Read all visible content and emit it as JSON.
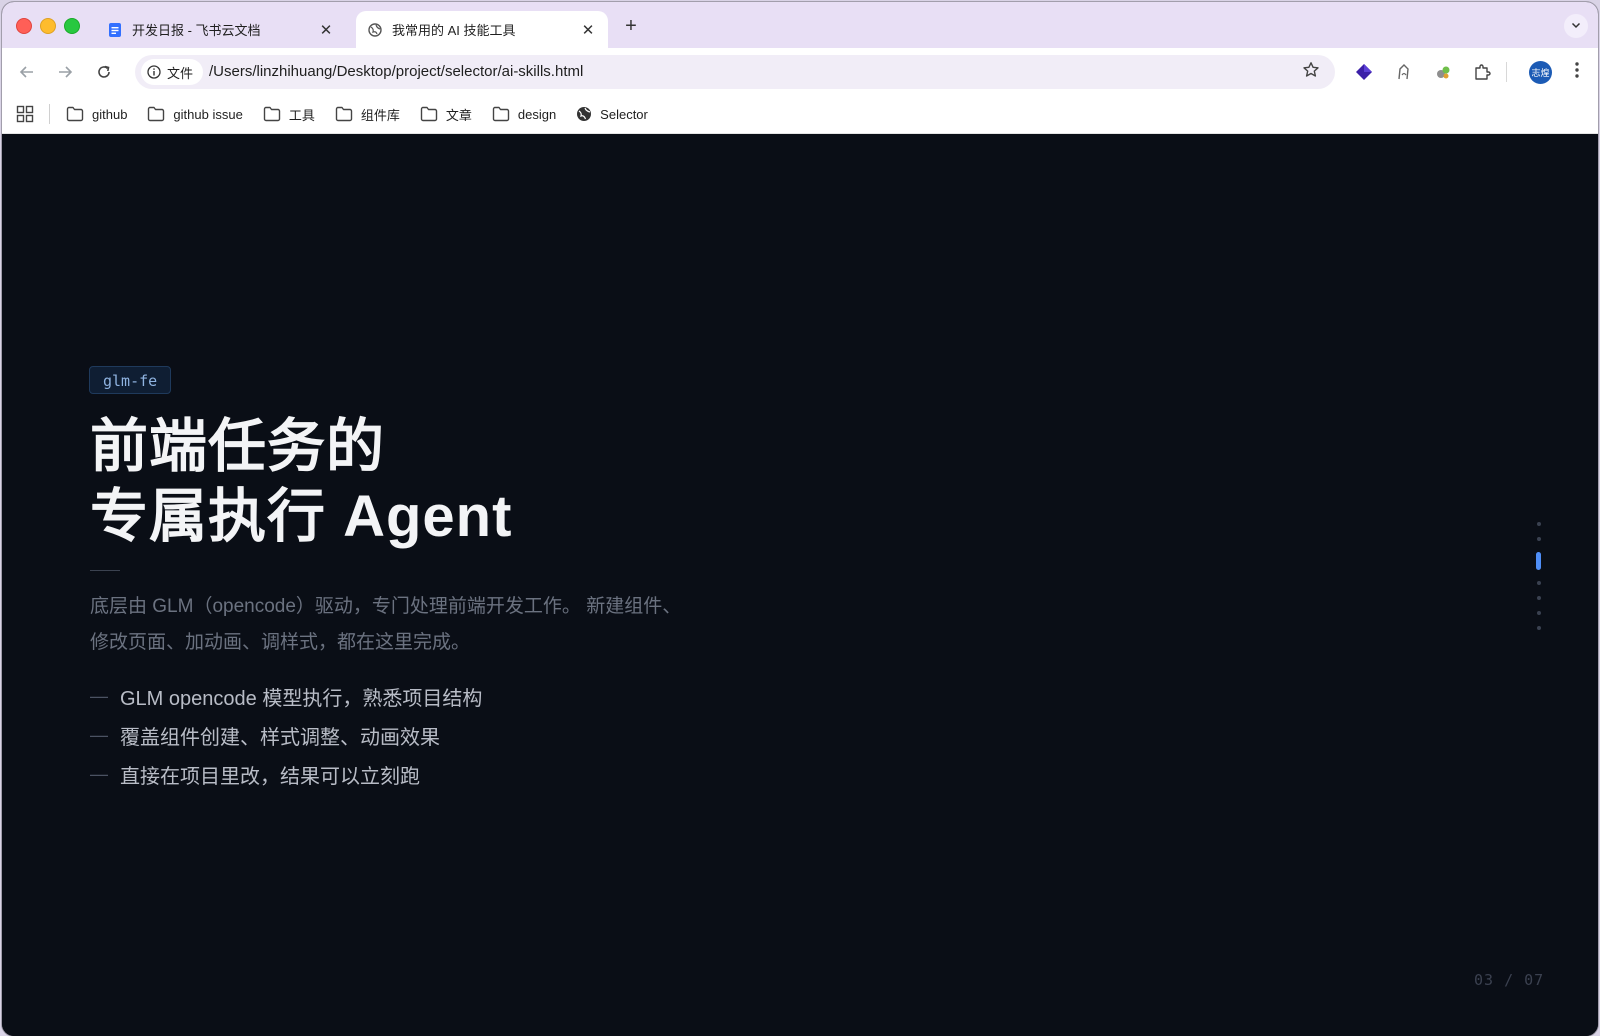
{
  "browser": {
    "tabs": [
      {
        "title": "开发日报 - 飞书云文档",
        "icon": "document-icon",
        "active": false
      },
      {
        "title": "我常用的 AI 技能工具",
        "icon": "globe-icon",
        "active": true
      }
    ],
    "new_tab_label": "+",
    "address": {
      "chip_label": "文件",
      "url": "/Users/linzhihuang/Desktop/project/selector/ai-skills.html"
    },
    "avatar_label": "志煌",
    "bookmarks": [
      {
        "label": "github",
        "icon": "folder-icon"
      },
      {
        "label": "github issue",
        "icon": "folder-icon"
      },
      {
        "label": "工具",
        "icon": "folder-icon"
      },
      {
        "label": "组件库",
        "icon": "folder-icon"
      },
      {
        "label": "文章",
        "icon": "folder-icon"
      },
      {
        "label": "design",
        "icon": "folder-icon"
      },
      {
        "label": "Selector",
        "icon": "globe-icon"
      }
    ]
  },
  "slide": {
    "tag": "glm-fe",
    "title_line1": "前端任务的",
    "title_line2": "专属执行 Agent",
    "description": "底层由 GLM（opencode）驱动，专门处理前端开发工作。 新建组件、修改页面、加动画、调样式，都在这里完成。",
    "bullet_marker": "—",
    "bullets": [
      "GLM opencode 模型执行，熟悉项目结构",
      "覆盖组件创建、样式调整、动画效果",
      "直接在项目里改，结果可以立刻跑"
    ],
    "counter": "03 / 07",
    "current_page": 3,
    "total_pages": 7
  },
  "colors": {
    "page_bg": "#0a0e16",
    "accent": "#4f8ef7",
    "tab_strip": "#e8dff5"
  }
}
